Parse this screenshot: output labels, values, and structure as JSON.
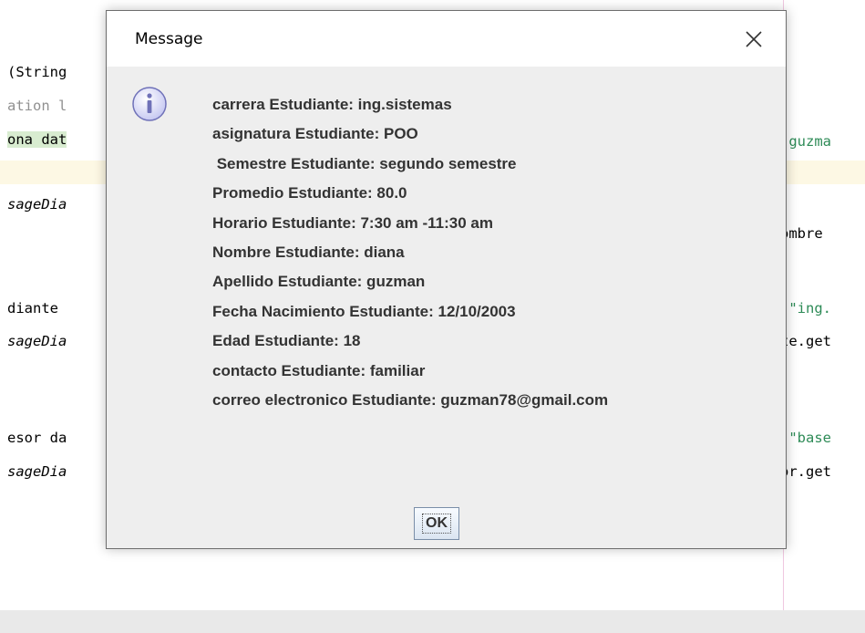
{
  "editor": {
    "left_lines": [
      {
        "text": "(String",
        "style": "normal"
      },
      {
        "text": "ation l",
        "style": "comment"
      },
      {
        "text": "ona dat",
        "style": "normal"
      },
      {
        "text": "sageDia",
        "style": "italic"
      },
      {
        "text": "diante ",
        "style": "normal"
      },
      {
        "text": "sageDia",
        "style": "italic"
      },
      {
        "text": "esor da",
        "style": "normal"
      },
      {
        "text": "sageDia",
        "style": "italic"
      }
    ],
    "right_lines": [
      {
        "text": "\"guzma"
      },
      {
        "text": "ombre"
      },
      {
        "text": "(\"ing."
      },
      {
        "text": "te.get"
      },
      {
        "text": ",\"base"
      },
      {
        "text": "or.get"
      }
    ]
  },
  "dialog": {
    "title": "Message",
    "close_icon": "close-icon",
    "icon": "info-icon",
    "lines": [
      "carrera Estudiante: ing.sistemas",
      "asignatura Estudiante: POO",
      " Semestre Estudiante: segundo semestre",
      "Promedio Estudiante: 80.0",
      "Horario Estudiante: 7:30 am -11:30 am",
      "Nombre Estudiante: diana",
      "Apellido Estudiante: guzman",
      "Fecha Nacimiento Estudiante: 12/10/2003",
      "Edad Estudiante: 18",
      "contacto Estudiante: familiar",
      "correo electronico Estudiante: guzman78@gmail.com"
    ],
    "ok_label": "OK"
  },
  "colors": {
    "dialog_bg": "#eeeeee",
    "titlebar_bg": "#ffffff",
    "string_green": "#2e8b57",
    "current_line": "#fdf8e4"
  }
}
